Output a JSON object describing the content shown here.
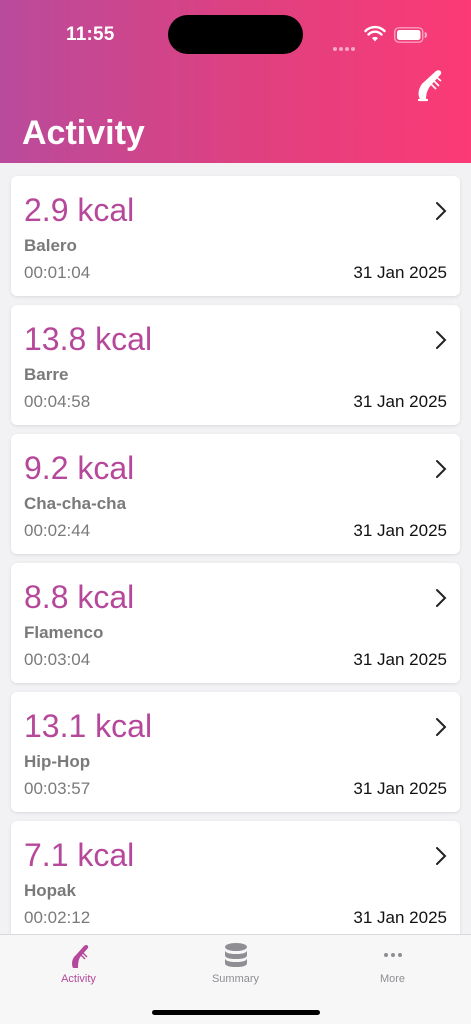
{
  "status_bar": {
    "time": "11:55"
  },
  "header": {
    "title": "Activity",
    "icon": "dance-shoe-icon"
  },
  "activities": [
    {
      "kcal": "2.9 kcal",
      "name": "Balero",
      "duration": "00:01:04",
      "date": "31 Jan 2025"
    },
    {
      "kcal": "13.8 kcal",
      "name": "Barre",
      "duration": "00:04:58",
      "date": "31 Jan 2025"
    },
    {
      "kcal": "9.2 kcal",
      "name": "Cha-cha-cha",
      "duration": "00:02:44",
      "date": "31 Jan 2025"
    },
    {
      "kcal": "8.8 kcal",
      "name": "Flamenco",
      "duration": "00:03:04",
      "date": "31 Jan 2025"
    },
    {
      "kcal": "13.1 kcal",
      "name": "Hip-Hop",
      "duration": "00:03:57",
      "date": "31 Jan 2025"
    },
    {
      "kcal": "7.1 kcal",
      "name": "Hopak",
      "duration": "00:02:12",
      "date": "31 Jan 2025"
    }
  ],
  "tab_bar": {
    "tabs": [
      {
        "label": "Activity",
        "icon": "dance-shoe-icon",
        "active": true
      },
      {
        "label": "Summary",
        "icon": "database-icon",
        "active": false
      },
      {
        "label": "More",
        "icon": "more-dots-icon",
        "active": false
      }
    ]
  },
  "colors": {
    "accent": "#b5489a",
    "header_start": "#b94b9c",
    "header_end": "#fb3a76"
  }
}
